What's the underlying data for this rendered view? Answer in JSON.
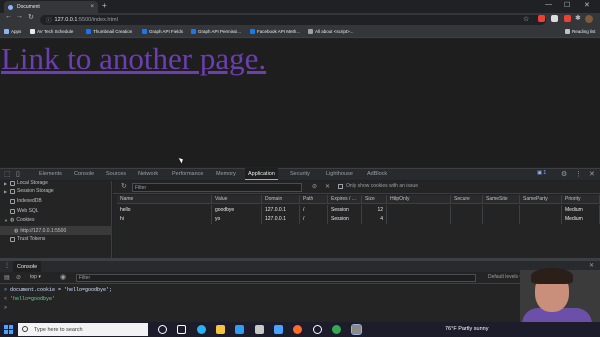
{
  "browser": {
    "tab_title": "Document",
    "new_tab_symbol": "+",
    "close_symbol": "×",
    "url_host": "127.0.0.1",
    "url_path": ":5500/index.html",
    "reading_list": "Reading list",
    "bookmarks": [
      {
        "label": "Apps",
        "icon": "apps-grid-icon",
        "color": "#8ab4f8"
      },
      {
        "label": "AV Tech Schedule",
        "icon": "page-icon",
        "color": "#e8eaed"
      },
      {
        "label": "Thumbnail Creation",
        "icon": "folder-icon",
        "color": "#1a73e8"
      },
      {
        "label": "Graph API Fields",
        "icon": "facebook-icon",
        "color": "#1877f2"
      },
      {
        "label": "Graph API Permissi...",
        "icon": "facebook-icon",
        "color": "#1877f2"
      },
      {
        "label": "Facebook API Meth...",
        "icon": "facebook-icon",
        "color": "#1877f2"
      },
      {
        "label": "All about <script>...",
        "icon": "page-icon",
        "color": "#9aa0a6"
      }
    ]
  },
  "page": {
    "link_text": "Link to another page."
  },
  "devtools": {
    "tabs": [
      "Elements",
      "Console",
      "Sources",
      "Network",
      "Performance",
      "Memory",
      "Application",
      "Security",
      "Lighthouse",
      "AdBlock"
    ],
    "active_tab": "Application",
    "issues_count": "1",
    "sidebar": [
      {
        "label": "Local Storage",
        "icon": "database-icon",
        "expanded": false
      },
      {
        "label": "Session Storage",
        "icon": "database-icon",
        "expanded": false
      },
      {
        "label": "IndexedDB",
        "icon": "database-icon",
        "expanded": false
      },
      {
        "label": "Web SQL",
        "icon": "database-icon",
        "expanded": false
      },
      {
        "label": "Cookies",
        "icon": "cookie-icon",
        "expanded": true
      },
      {
        "label": "http://127.0.0.1:5500",
        "icon": "cookie-icon",
        "selected": true
      },
      {
        "label": "Trust Tokens",
        "icon": "database-icon",
        "expanded": false
      }
    ],
    "cookie_filter_placeholder": "Filter",
    "only_issue_label": "Only show cookies with an issue",
    "columns": [
      "Name",
      "Value",
      "Domain",
      "Path",
      "Expires / ...",
      "Size",
      "HttpOnly",
      "Secure",
      "SameSite",
      "SameParty",
      "Priority"
    ],
    "rows": [
      [
        "hello",
        "goodbye",
        "127.0.0.1",
        "/",
        "Session",
        "12",
        "",
        "",
        "",
        "",
        "Medium"
      ],
      [
        "hi",
        "yo",
        "127.0.0.1",
        "/",
        "Session",
        "4",
        "",
        "",
        "",
        "",
        "Medium"
      ]
    ]
  },
  "console": {
    "tab_label": "Console",
    "context": "top",
    "filter_placeholder": "Filter",
    "levels": "Default levels",
    "lines": [
      {
        "prefix": ">",
        "text": "document.cookie = 'hello=goodbye';",
        "color": "#d2e3fc"
      },
      {
        "prefix": "<",
        "text": "'hello=goodbye'",
        "color": "#5fd4a3"
      },
      {
        "prefix": ">",
        "text": "",
        "color": "#8ab4f8"
      }
    ]
  },
  "taskbar": {
    "search_placeholder": "Type here to search",
    "weather": "76°F  Partly sunny"
  }
}
